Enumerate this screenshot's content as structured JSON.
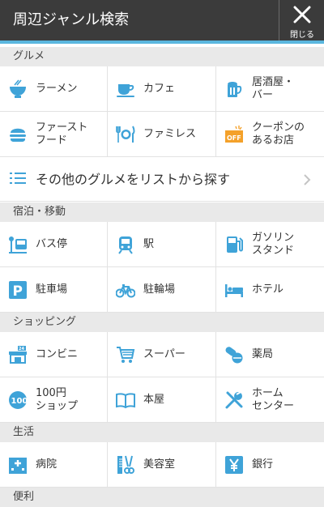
{
  "header": {
    "title": "周辺ジャンル検索",
    "close_label": "閉じる"
  },
  "sections": {
    "gourmet": "グルメ",
    "stay": "宿泊・移動",
    "shopping": "ショッピング",
    "life": "生活",
    "convenience": "便利"
  },
  "items": {
    "ramen": "ラーメン",
    "cafe": "カフェ",
    "izakaya": "居酒屋・\nバー",
    "fastfood": "ファースト\nフード",
    "famires": "ファミレス",
    "coupon": "クーポンの\nあるお店",
    "busstop": "バス停",
    "station": "駅",
    "gas": "ガソリン\nスタンド",
    "parking": "駐車場",
    "bikeparking": "駐輪場",
    "hotel": "ホテル",
    "conbini": "コンビニ",
    "super": "スーパー",
    "pharmacy": "薬局",
    "hyakuen": "100円\nショップ",
    "books": "本屋",
    "homecenter": "ホーム\nセンター",
    "hospital": "病院",
    "beauty": "美容室",
    "bank": "銀行"
  },
  "list_more": {
    "label": "その他のグルメをリストから探す"
  },
  "colors": {
    "accent": "#5ab6de",
    "icon": "#3fa3d8",
    "coupon": "#f4a12a",
    "header": "#3b3b3b"
  }
}
